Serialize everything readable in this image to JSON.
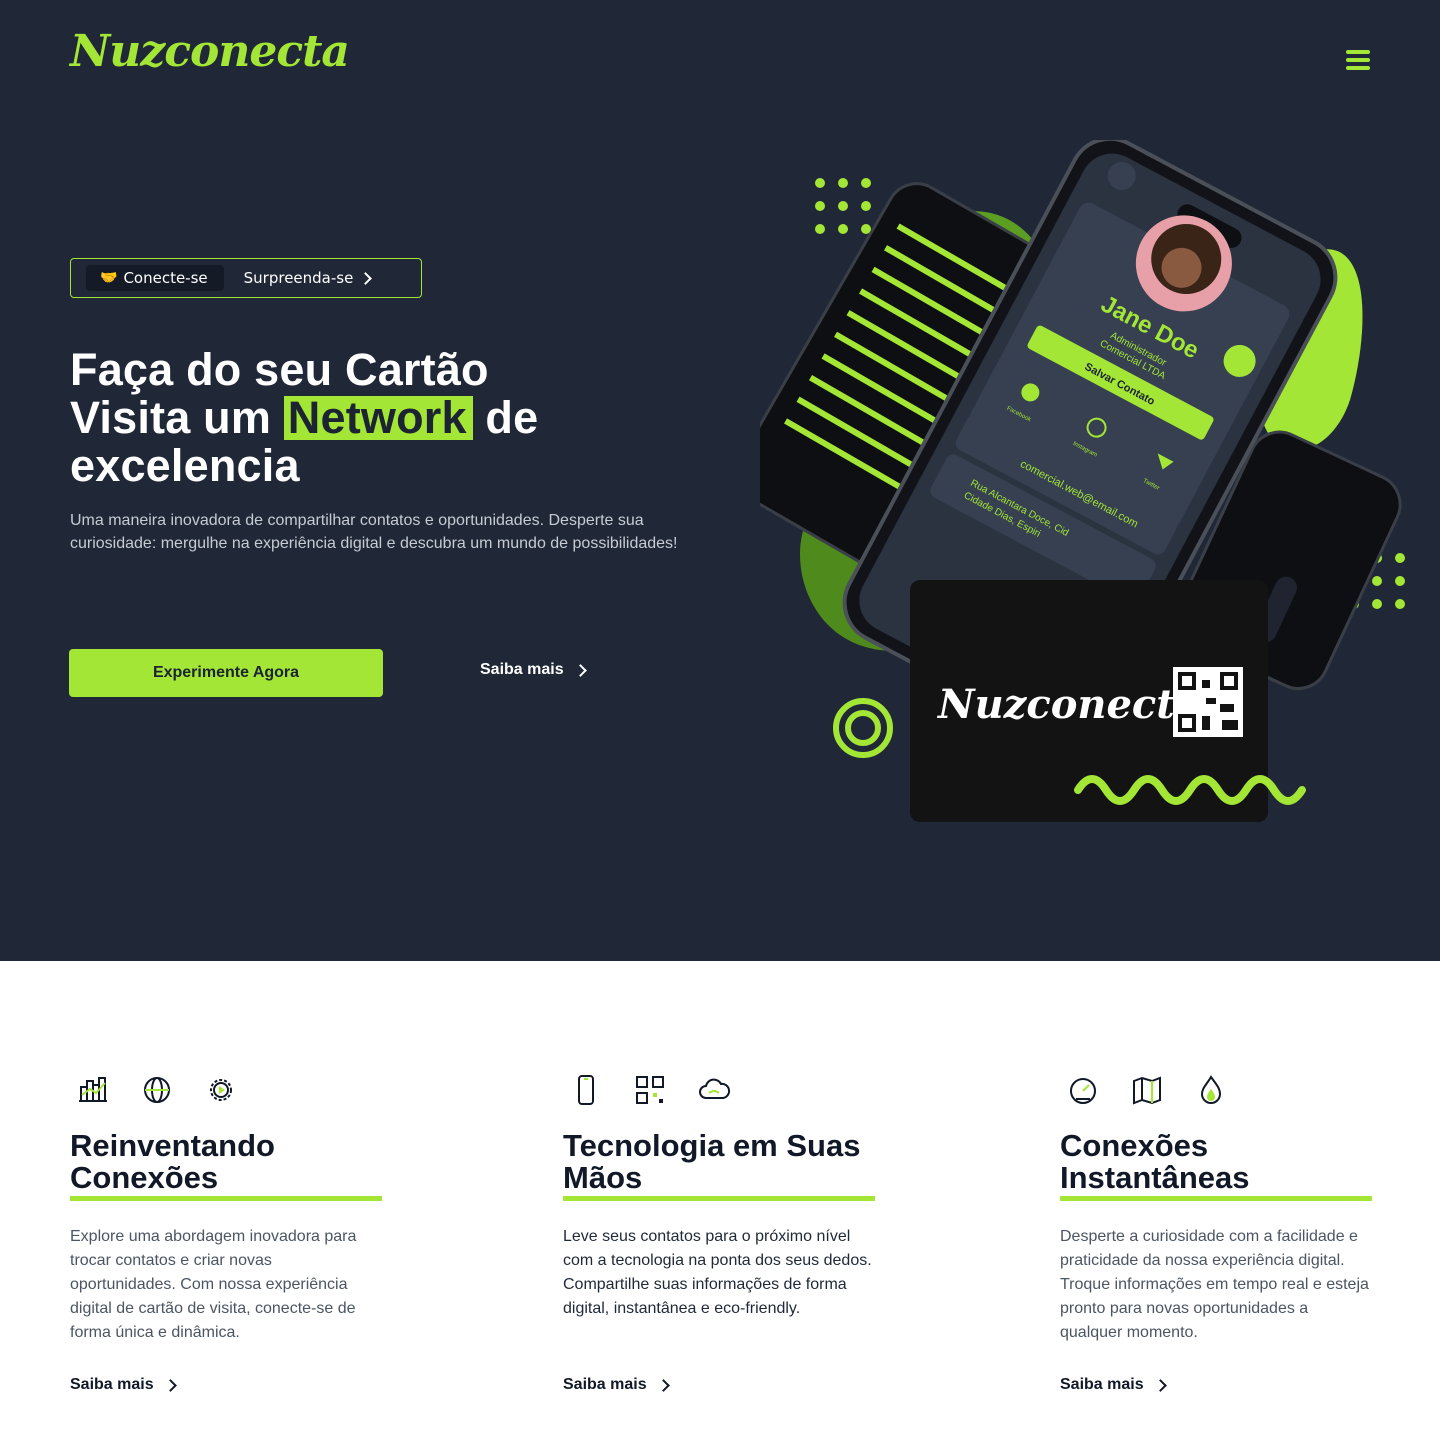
{
  "brand": {
    "logo_text": "Nuzconecta",
    "accent": "#a3e635",
    "background": "#202838"
  },
  "nav": {
    "menu_icon": "hamburger-menu-icon"
  },
  "hero": {
    "pill_tag": "Conecte-se",
    "pill_tag_icon": "handshake-icon",
    "pill_link": "Surpreenda-se",
    "headline_line1": "Faça do seu Cartão",
    "headline_line2_pre": "Visita um",
    "headline_highlight": "Network",
    "headline_line2_post": "de",
    "headline_line3": "excelencia",
    "description": "Uma maneira inovadora de compartilhar contatos e oportunidades. Desperte sua curiosidade: mergulhe na  experiência digital e descubra um mundo de possibilidades!",
    "cta_primary": "Experimente Agora",
    "cta_secondary": "Saiba mais"
  },
  "phone_card": {
    "name": "Jane Doe",
    "role_line1": "Administrador",
    "role_line2": "Comercial LTDA",
    "save_button": "Salvar Contato",
    "social_facebook": "Facebook",
    "social_instagram": "Instagram",
    "social_twitter": "Twitter",
    "email": "comercial.web@email.com",
    "address_line1": "Rua Alcantara Doce, Cid",
    "address_line2": "Cidade Dias, Espiri"
  },
  "physical_card": {
    "logo_text": "Nuzconecta"
  },
  "features": [
    {
      "icons": [
        "chart-bars-icon",
        "globe-icon",
        "gear-play-icon"
      ],
      "title": "Reinventando Conexões",
      "description": "Explore uma abordagem inovadora para trocar contatos e criar novas oportunidades. Com nossa experiência digital de cartão de visita, conecte-se de forma única e dinâmica.",
      "link": "Saiba mais"
    },
    {
      "icons": [
        "smartphone-icon",
        "qr-code-icon",
        "cloud-icon"
      ],
      "title": "Tecnologia em Suas Mãos",
      "description": "Leve seus contatos para o próximo nível com a tecnologia na ponta dos seus dedos. Compartilhe suas informações de forma digital, instantânea e eco-friendly.",
      "link": "Saiba mais"
    },
    {
      "icons": [
        "speedometer-icon",
        "map-icon",
        "flame-icon"
      ],
      "title": "Conexões Instantâneas",
      "description": "Desperte a curiosidade com a facilidade e praticidade da nossa experiência digital. Troque informações em tempo real e esteja pronto para novas oportunidades a qualquer momento.",
      "link": "Saiba mais"
    }
  ]
}
